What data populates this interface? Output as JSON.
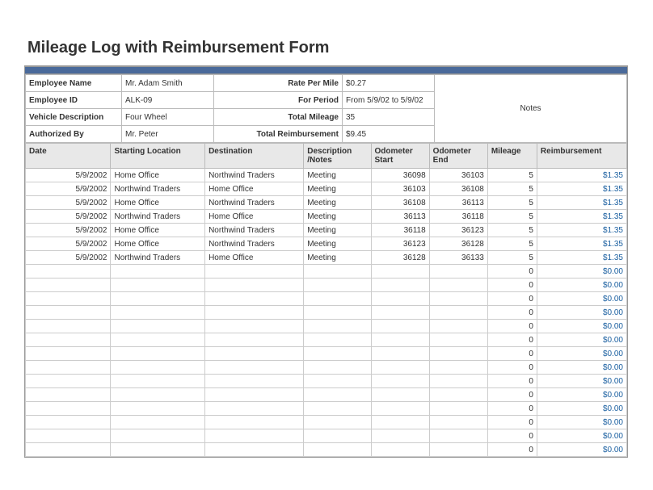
{
  "title": "Mileage Log with Reimbursement Form",
  "meta": {
    "labels": {
      "employee_name": "Employee Name",
      "employee_id": "Employee ID",
      "vehicle_desc": "Vehicle Description",
      "authorized_by": "Authorized By",
      "rate_per_mile": "Rate Per Mile",
      "for_period": "For Period",
      "total_mileage": "Total Mileage",
      "total_reimb": "Total Reimbursement",
      "notes": "Notes"
    },
    "values": {
      "employee_name": "Mr. Adam Smith",
      "employee_id": "ALK-09",
      "vehicle_desc": "Four Wheel",
      "authorized_by": "Mr. Peter",
      "rate_per_mile": "$0.27",
      "for_period": "From 5/9/02 to 5/9/02",
      "total_mileage": "35",
      "total_reimb": "$9.45"
    }
  },
  "columns": {
    "date": "Date",
    "start": "Starting Location",
    "dest": "Destination",
    "desc": "Description /Notes",
    "ostart": "Odometer Start",
    "oend": "Odometer End",
    "mileage": "Mileage",
    "reimb": "Reimbursement"
  },
  "rows": [
    {
      "date": "5/9/2002",
      "start": "Home Office",
      "dest": "Northwind Traders",
      "desc": "Meeting",
      "ostart": "36098",
      "oend": "36103",
      "mileage": "5",
      "reimb": "$1.35"
    },
    {
      "date": "5/9/2002",
      "start": "Northwind Traders",
      "dest": "Home Office",
      "desc": "Meeting",
      "ostart": "36103",
      "oend": "36108",
      "mileage": "5",
      "reimb": "$1.35"
    },
    {
      "date": "5/9/2002",
      "start": "Home Office",
      "dest": "Northwind Traders",
      "desc": "Meeting",
      "ostart": "36108",
      "oend": "36113",
      "mileage": "5",
      "reimb": "$1.35"
    },
    {
      "date": "5/9/2002",
      "start": "Northwind Traders",
      "dest": "Home Office",
      "desc": "Meeting",
      "ostart": "36113",
      "oend": "36118",
      "mileage": "5",
      "reimb": "$1.35"
    },
    {
      "date": "5/9/2002",
      "start": "Home Office",
      "dest": "Northwind Traders",
      "desc": "Meeting",
      "ostart": "36118",
      "oend": "36123",
      "mileage": "5",
      "reimb": "$1.35"
    },
    {
      "date": "5/9/2002",
      "start": "Home Office",
      "dest": "Northwind Traders",
      "desc": "Meeting",
      "ostart": "36123",
      "oend": "36128",
      "mileage": "5",
      "reimb": "$1.35"
    },
    {
      "date": "5/9/2002",
      "start": "Northwind Traders",
      "dest": "Home Office",
      "desc": "Meeting",
      "ostart": "36128",
      "oend": "36133",
      "mileage": "5",
      "reimb": "$1.35"
    },
    {
      "date": "",
      "start": "",
      "dest": "",
      "desc": "",
      "ostart": "",
      "oend": "",
      "mileage": "0",
      "reimb": "$0.00"
    },
    {
      "date": "",
      "start": "",
      "dest": "",
      "desc": "",
      "ostart": "",
      "oend": "",
      "mileage": "0",
      "reimb": "$0.00"
    },
    {
      "date": "",
      "start": "",
      "dest": "",
      "desc": "",
      "ostart": "",
      "oend": "",
      "mileage": "0",
      "reimb": "$0.00"
    },
    {
      "date": "",
      "start": "",
      "dest": "",
      "desc": "",
      "ostart": "",
      "oend": "",
      "mileage": "0",
      "reimb": "$0.00"
    },
    {
      "date": "",
      "start": "",
      "dest": "",
      "desc": "",
      "ostart": "",
      "oend": "",
      "mileage": "0",
      "reimb": "$0.00"
    },
    {
      "date": "",
      "start": "",
      "dest": "",
      "desc": "",
      "ostart": "",
      "oend": "",
      "mileage": "0",
      "reimb": "$0.00"
    },
    {
      "date": "",
      "start": "",
      "dest": "",
      "desc": "",
      "ostart": "",
      "oend": "",
      "mileage": "0",
      "reimb": "$0.00"
    },
    {
      "date": "",
      "start": "",
      "dest": "",
      "desc": "",
      "ostart": "",
      "oend": "",
      "mileage": "0",
      "reimb": "$0.00"
    },
    {
      "date": "",
      "start": "",
      "dest": "",
      "desc": "",
      "ostart": "",
      "oend": "",
      "mileage": "0",
      "reimb": "$0.00"
    },
    {
      "date": "",
      "start": "",
      "dest": "",
      "desc": "",
      "ostart": "",
      "oend": "",
      "mileage": "0",
      "reimb": "$0.00"
    },
    {
      "date": "",
      "start": "",
      "dest": "",
      "desc": "",
      "ostart": "",
      "oend": "",
      "mileage": "0",
      "reimb": "$0.00"
    },
    {
      "date": "",
      "start": "",
      "dest": "",
      "desc": "",
      "ostart": "",
      "oend": "",
      "mileage": "0",
      "reimb": "$0.00"
    },
    {
      "date": "",
      "start": "",
      "dest": "",
      "desc": "",
      "ostart": "",
      "oend": "",
      "mileage": "0",
      "reimb": "$0.00"
    },
    {
      "date": "",
      "start": "",
      "dest": "",
      "desc": "",
      "ostart": "",
      "oend": "",
      "mileage": "0",
      "reimb": "$0.00"
    }
  ]
}
